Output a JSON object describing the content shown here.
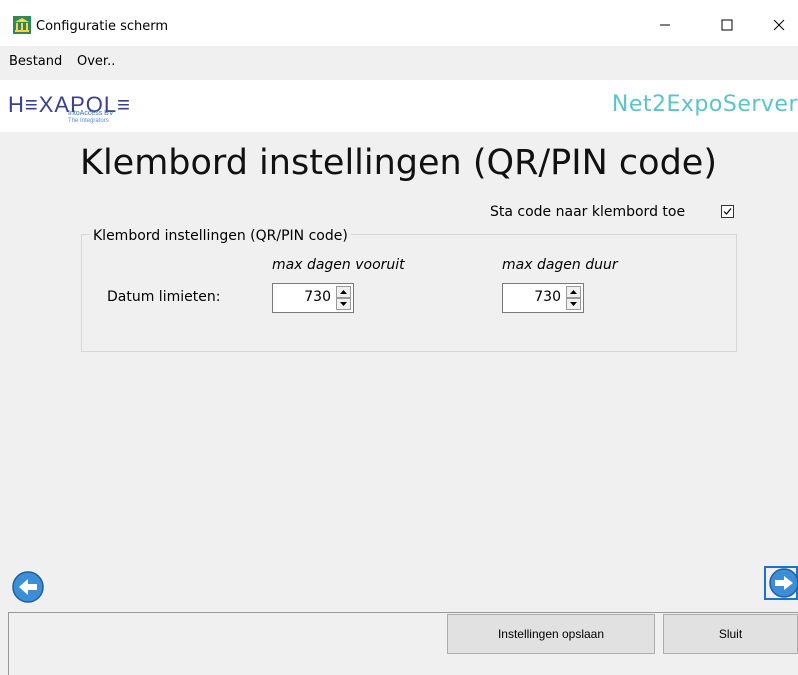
{
  "window": {
    "title": "Configuratie scherm",
    "icon": "bank-icon"
  },
  "menu": {
    "items": [
      "Bestand",
      "Over.."
    ]
  },
  "header": {
    "logo_text": "HEXAPOLE",
    "logo_sub1": "IntoAccess BV",
    "logo_sub2": "The Integrators",
    "app_name": "Net2ExpoServer",
    "accent_color": "#5cc3c9"
  },
  "page": {
    "title": "Klembord instellingen (QR/PIN code)",
    "checkbox_label": "Sta code naar klembord toe",
    "checkbox_checked": true
  },
  "group": {
    "legend": "Klembord instellingen (QR/PIN code)",
    "col_ahead": "max dagen vooruit",
    "col_duration": "max dagen duur",
    "row_label": "Datum limieten:",
    "ahead_value": "730",
    "duration_value": "730"
  },
  "buttons": {
    "save": "Instellingen opslaan",
    "close": "Sluit"
  }
}
